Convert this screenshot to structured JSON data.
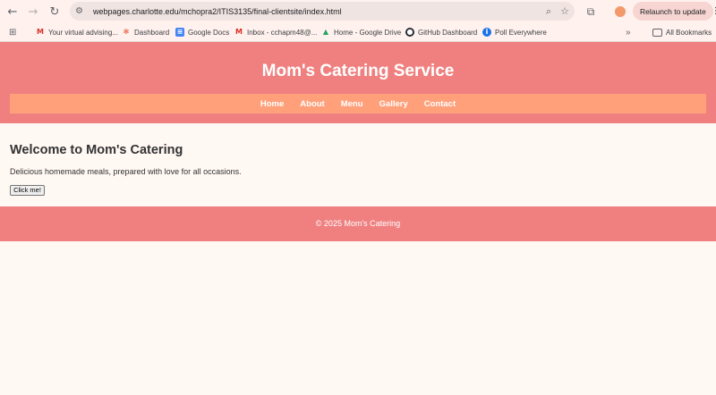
{
  "browser": {
    "url": "webpages.charlotte.edu/mchopra2/ITIS3135/final-clientsite/index.html",
    "relaunch_label": "Relaunch to update",
    "icons": {
      "back": "back-arrow-icon",
      "forward": "forward-arrow-icon",
      "reload": "reload-icon",
      "site_info": "site-info-icon",
      "zoom": "zoom-icon",
      "star": "star-icon",
      "extensions": "extensions-icon",
      "profile": "profile-icon",
      "menu": "kebab-menu-icon"
    },
    "bookmarks": [
      {
        "label": "Your virtual advising...",
        "icon": "gmail-icon"
      },
      {
        "label": "Dashboard",
        "icon": "canvas-icon"
      },
      {
        "label": "Google Docs",
        "icon": "docs-icon"
      },
      {
        "label": "Inbox - cchapm48@...",
        "icon": "gmail-icon"
      },
      {
        "label": "Home - Google Drive",
        "icon": "drive-icon"
      },
      {
        "label": "GitHub Dashboard",
        "icon": "github-icon"
      },
      {
        "label": "Poll Everywhere",
        "icon": "poll-icon"
      }
    ],
    "all_bookmarks_label": "All Bookmarks"
  },
  "site": {
    "title": "Mom's Catering Service",
    "nav": [
      "Home",
      "About",
      "Menu",
      "Gallery",
      "Contact"
    ],
    "heading": "Welcome to Mom's Catering",
    "tagline": "Delicious homemade meals, prepared with love for all occasions.",
    "button_label": "Click me!",
    "footer": "© 2025 Mom's Catering"
  },
  "colors": {
    "header": "#f08080",
    "nav": "#ffa07a",
    "background": "#fff8f3"
  }
}
